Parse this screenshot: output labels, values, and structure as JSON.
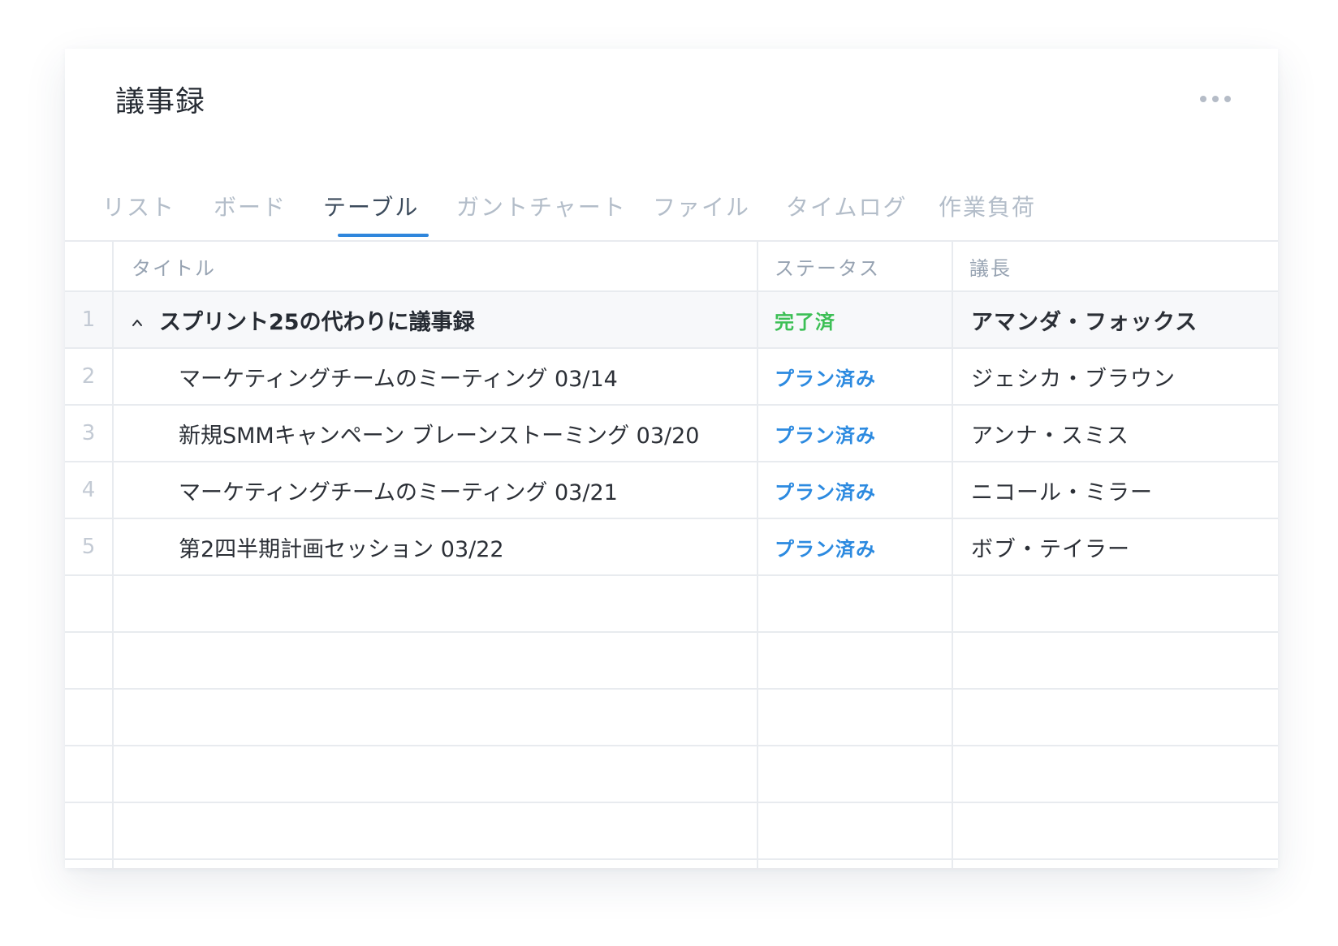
{
  "panel": {
    "title": "議事録"
  },
  "tabs": [
    {
      "label": "リスト",
      "active": false
    },
    {
      "label": "ボード",
      "active": false
    },
    {
      "label": "テーブル",
      "active": true
    },
    {
      "label": "ガントチャート",
      "active": false
    },
    {
      "label": "ファイル",
      "active": false
    },
    {
      "label": "タイムログ",
      "active": false
    },
    {
      "label": "作業負荷",
      "active": false
    }
  ],
  "table": {
    "columns": {
      "title": "タイトル",
      "status": "ステータス",
      "chair": "議長"
    },
    "rows": [
      {
        "num": "1",
        "title": "スプリント25の代わりに議事録",
        "status": "完了済",
        "chair": "アマンダ・フォックス"
      },
      {
        "num": "2",
        "title": "マーケティングチームのミーティング 03/14",
        "status": "プラン済み",
        "chair": "ジェシカ・ブラウン"
      },
      {
        "num": "3",
        "title": "新規SMMキャンペーン ブレーンストーミング 03/20",
        "status": "プラン済み",
        "chair": "アンナ・スミス"
      },
      {
        "num": "4",
        "title": "マーケティングチームのミーティング 03/21",
        "status": "プラン済み",
        "chair": "ニコール・ミラー"
      },
      {
        "num": "5",
        "title": "第2四半期計画セッション 03/22",
        "status": "プラン済み",
        "chair": "ボブ・テイラー"
      }
    ]
  },
  "icons": {
    "more": "more-horizontal-icon",
    "collapse": "chevron-up-icon"
  },
  "colors": {
    "accent": "#2f86dc",
    "status_done": "#3cbf55",
    "status_planned": "#2c8ae0"
  }
}
